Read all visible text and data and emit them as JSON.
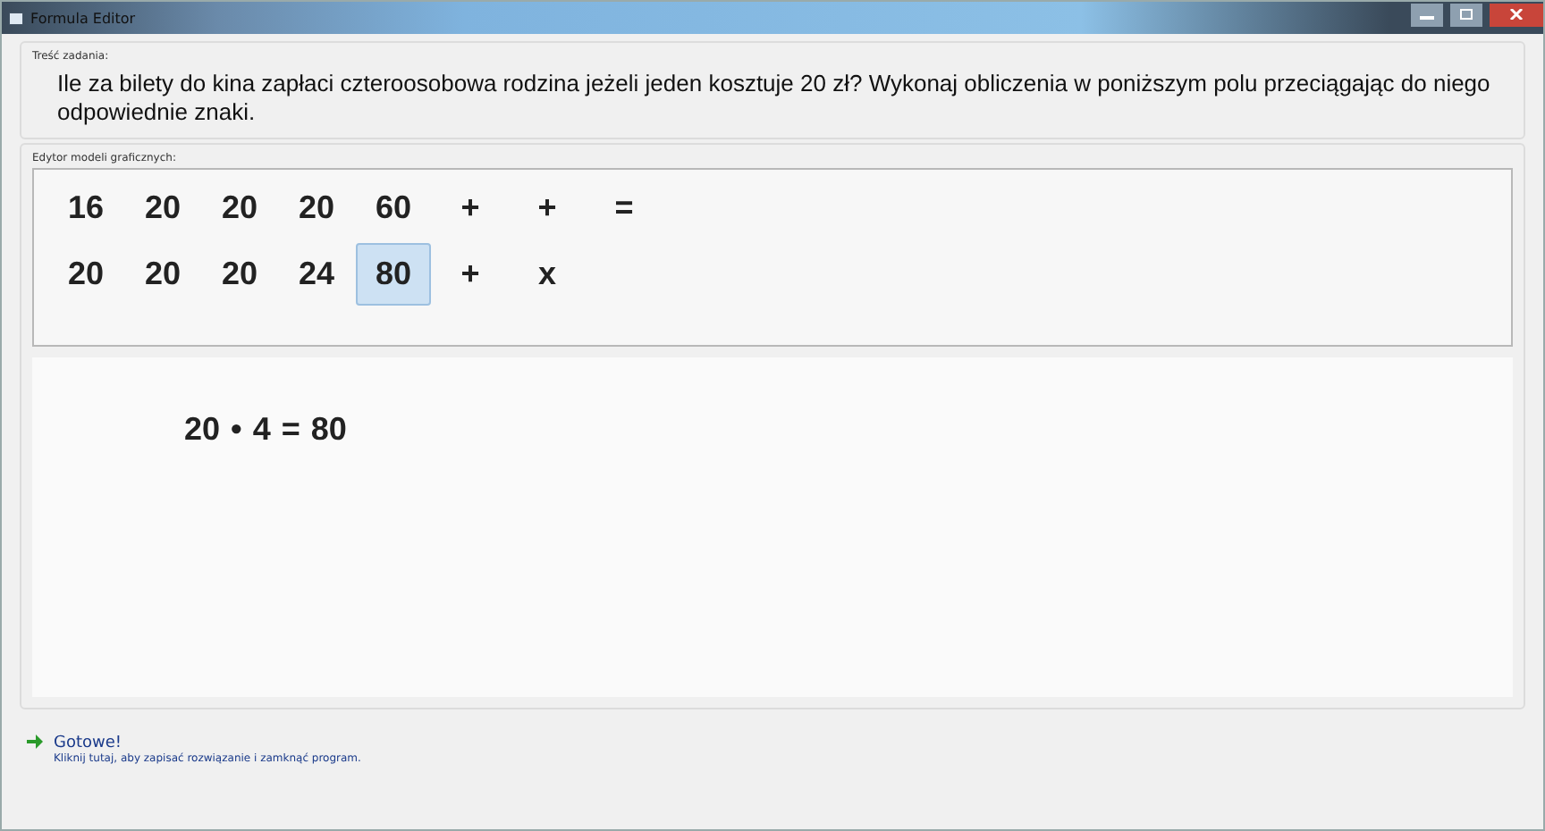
{
  "window": {
    "title": "Formula Editor"
  },
  "task": {
    "legend": "Treść zadania:",
    "text": "Ile za bilety do kina zapłaci czteroosobowa rodzina jeżeli jeden kosztuje 20 zł? Wykonaj obliczenia w poniższym polu przeciągając do niego odpowiednie znaki."
  },
  "editor": {
    "legend": "Edytor modeli graficznych:",
    "palette_rows": [
      [
        {
          "label": "16",
          "selected": false
        },
        {
          "label": "20",
          "selected": false
        },
        {
          "label": "20",
          "selected": false
        },
        {
          "label": "20",
          "selected": false
        },
        {
          "label": "60",
          "selected": false
        },
        {
          "label": "+",
          "selected": false
        },
        {
          "label": "+",
          "selected": false
        },
        {
          "label": "=",
          "selected": false
        }
      ],
      [
        {
          "label": "20",
          "selected": false
        },
        {
          "label": "20",
          "selected": false
        },
        {
          "label": "20",
          "selected": false
        },
        {
          "label": "24",
          "selected": false
        },
        {
          "label": "80",
          "selected": true
        },
        {
          "label": "+",
          "selected": false
        },
        {
          "label": "x",
          "selected": false
        }
      ]
    ],
    "equation": [
      "20",
      "•",
      "4",
      "=",
      "80"
    ]
  },
  "footer": {
    "title": "Gotowe!",
    "hint": "Kliknij tutaj, aby zapisać rozwiązanie i zamknąć program."
  }
}
